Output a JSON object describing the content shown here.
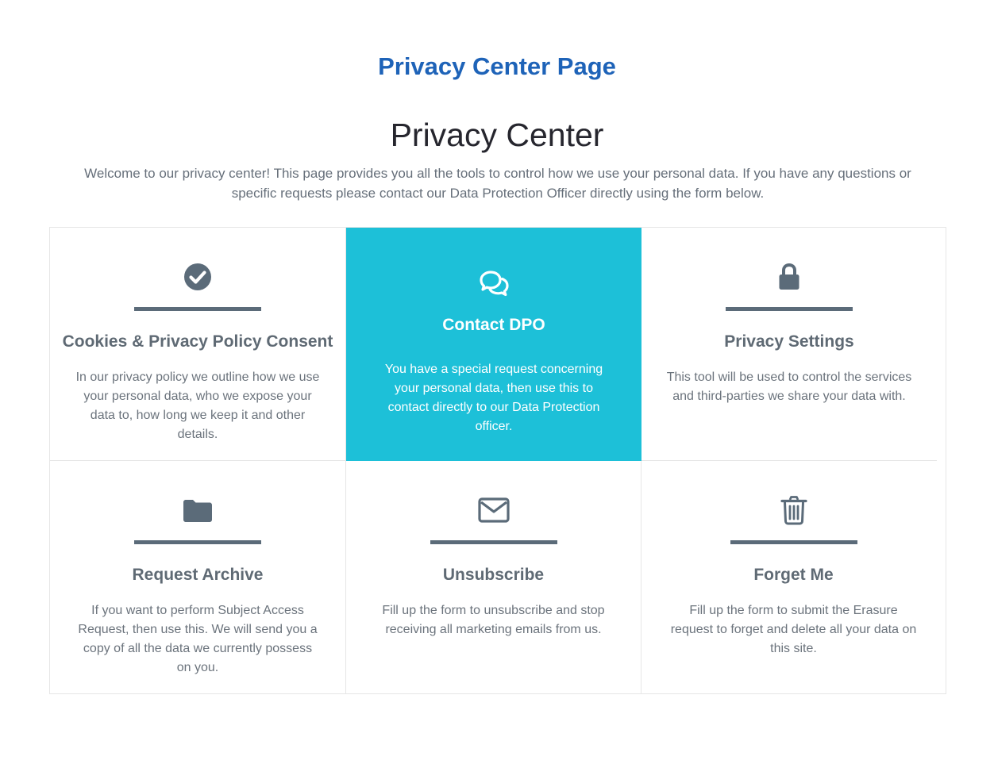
{
  "page": {
    "heading": "Privacy Center Page",
    "title": "Privacy Center",
    "intro": "Welcome to our privacy center! This page provides you all the tools to control how we use your personal data. If you have any questions or specific requests please contact our Data Protection Officer directly using the form below."
  },
  "colors": {
    "heading": "#1e63b8",
    "highlight_card": "#1dc0d8",
    "icon": "#5b6b79"
  },
  "cards": [
    {
      "icon": "check-circle-icon",
      "title": "Cookies & Privacy Policy Consent",
      "text": "In our privacy policy we outline how we use your personal data, who we expose your data to, how long we keep it and other details."
    },
    {
      "icon": "chat-bubbles-icon",
      "title": "Contact DPO",
      "text": "You have a special request concerning your personal data, then use this to contact directly to our Data Protection officer."
    },
    {
      "icon": "lock-icon",
      "title": "Privacy Settings",
      "text": "This tool will be used to control the services and third-parties we share your data with."
    },
    {
      "icon": "folder-icon",
      "title": "Request Archive",
      "text": "If you want to perform Subject Access Request, then use this. We will send you a copy of all the data we currently possess on you."
    },
    {
      "icon": "envelope-icon",
      "title": "Unsubscribe",
      "text": "Fill up the form to unsubscribe and stop receiving all marketing emails from us."
    },
    {
      "icon": "trash-icon",
      "title": "Forget Me",
      "text": "Fill up the form to submit the Erasure request to forget and delete all your data on this site."
    }
  ]
}
